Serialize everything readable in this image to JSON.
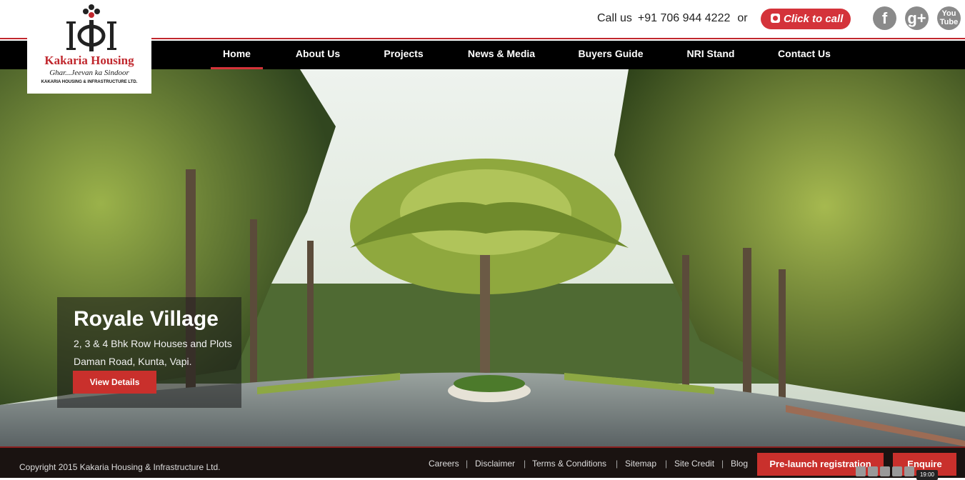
{
  "logo": {
    "name": "Kakaria Housing",
    "tagline": "Ghar...Jeevan ka Sindoor",
    "company": "KAKARIA HOUSING & INFRASTRUCTURE LTD."
  },
  "header": {
    "call_label": "Call us",
    "phone": "+91 706 944 4222",
    "or": "or",
    "click_to_call": "Click to call",
    "social": [
      {
        "name": "facebook-icon",
        "glyph": "f"
      },
      {
        "name": "google-plus-icon",
        "glyph": "g+"
      },
      {
        "name": "youtube-icon",
        "glyph": "You Tube"
      }
    ]
  },
  "nav": {
    "items": [
      {
        "label": "Home",
        "active": true
      },
      {
        "label": "About Us"
      },
      {
        "label": "Projects"
      },
      {
        "label": "News & Media"
      },
      {
        "label": "Buyers Guide"
      },
      {
        "label": "NRI Stand"
      },
      {
        "label": "Contact Us"
      }
    ]
  },
  "hero": {
    "title": "Royale Village",
    "line1": "2, 3 & 4 Bhk Row Houses and Plots",
    "line2": "Daman Road, Kunta, Vapi.",
    "cta": "View Details"
  },
  "footer": {
    "copyright": "Copyright 2015 Kakaria Housing & Infrastructure Ltd.",
    "links": [
      "Careers",
      "Disclaimer",
      "Terms & Conditions",
      "Sitemap",
      "Site Credit",
      "Blog"
    ],
    "prelaunch": "Pre-launch registration",
    "enquire": "Enquire",
    "clock": "19:00"
  },
  "colors": {
    "accent": "#d4333a",
    "nav_bg": "#000000",
    "footer_bg": "#1a1311"
  }
}
